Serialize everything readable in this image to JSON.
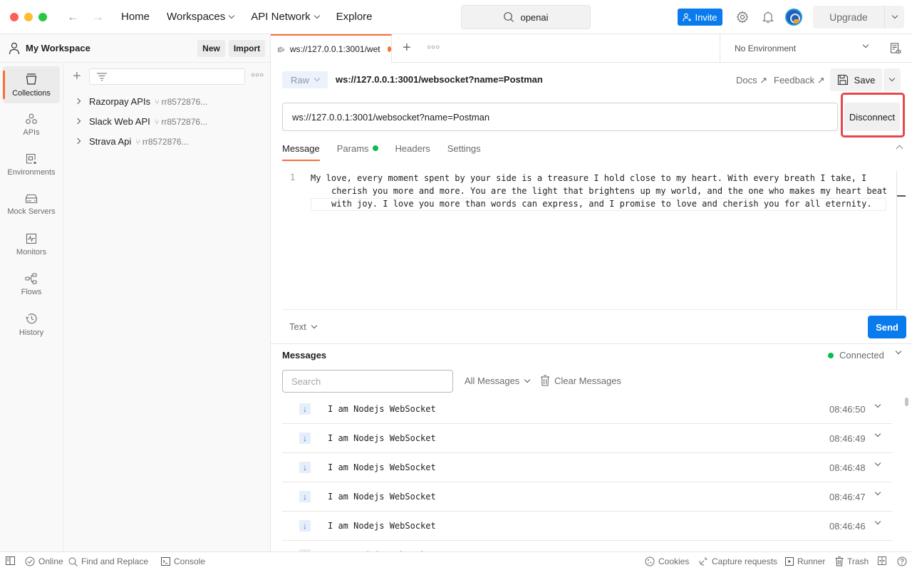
{
  "titlebar": {
    "nav": [
      {
        "label": "Home",
        "has_dropdown": false
      },
      {
        "label": "Workspaces",
        "has_dropdown": true
      },
      {
        "label": "API Network",
        "has_dropdown": true
      },
      {
        "label": "Explore",
        "has_dropdown": false
      }
    ],
    "search_value": "openai",
    "invite_label": "Invite",
    "upgrade_label": "Upgrade"
  },
  "workspace": {
    "name": "My Workspace",
    "new_label": "New",
    "import_label": "Import"
  },
  "rail": [
    {
      "label": "Collections",
      "icon": "collections-icon",
      "active": true
    },
    {
      "label": "APIs",
      "icon": "apis-icon",
      "active": false
    },
    {
      "label": "Environments",
      "icon": "environments-icon",
      "active": false
    },
    {
      "label": "Mock Servers",
      "icon": "mock-servers-icon",
      "active": false
    },
    {
      "label": "Monitors",
      "icon": "monitors-icon",
      "active": false
    },
    {
      "label": "Flows",
      "icon": "flows-icon",
      "active": false
    },
    {
      "label": "History",
      "icon": "history-icon",
      "active": false
    }
  ],
  "collections": [
    {
      "name": "Razorpay APIs",
      "owner": "rr8572876..."
    },
    {
      "name": "Slack Web API",
      "owner": "rr8572876..."
    },
    {
      "name": "Strava Api",
      "owner": "rr8572876..."
    }
  ],
  "tab": {
    "title": "ws://127.0.0.1:3001/wet",
    "unsaved": true
  },
  "environment": {
    "selected": "No Environment"
  },
  "request": {
    "mode": "Raw",
    "title": "ws://127.0.0.1:3001/websocket?name=Postman",
    "docs_label": "Docs ↗",
    "feedback_label": "Feedback ↗",
    "save_label": "Save",
    "url": "ws://127.0.0.1:3001/websocket?name=Postman",
    "disconnect_label": "Disconnect"
  },
  "subtabs": [
    {
      "label": "Message",
      "active": true,
      "dot": false
    },
    {
      "label": "Params",
      "active": false,
      "dot": true
    },
    {
      "label": "Headers",
      "active": false,
      "dot": false
    },
    {
      "label": "Settings",
      "active": false,
      "dot": false
    }
  ],
  "editor": {
    "line_number": "1",
    "content": "My love, every moment spent by your side is a treasure I hold close to my heart. With every breath I take, I cherish you more and more. You are the light that brightens up my world, and the one who makes my heart beat with joy. I love you more than words can express, and I promise to love and cherish you for all eternity.",
    "format": "Text",
    "send_label": "Send"
  },
  "messages": {
    "title": "Messages",
    "status": "Connected",
    "status_color": "#0cbb52",
    "search_placeholder": "Search",
    "filter": "All Messages",
    "clear_label": "Clear Messages",
    "items": [
      {
        "direction": "incoming",
        "text": "I am Nodejs WebSocket",
        "time": "08:46:50"
      },
      {
        "direction": "incoming",
        "text": "I am Nodejs WebSocket",
        "time": "08:46:49"
      },
      {
        "direction": "incoming",
        "text": "I am Nodejs WebSocket",
        "time": "08:46:48"
      },
      {
        "direction": "incoming",
        "text": "I am Nodejs WebSocket",
        "time": "08:46:47"
      },
      {
        "direction": "incoming",
        "text": "I am Nodejs WebSocket",
        "time": "08:46:46"
      },
      {
        "direction": "incoming",
        "text": "I am Nodejs WebSocket",
        "time": ""
      }
    ]
  },
  "statusbar": {
    "online": "Online",
    "find_replace": "Find and Replace",
    "console": "Console",
    "cookies": "Cookies",
    "capture": "Capture requests",
    "runner": "Runner",
    "trash": "Trash"
  },
  "colors": {
    "accent": "#ff6c37",
    "primary": "#097bed",
    "highlight_box": "#e8464d"
  }
}
